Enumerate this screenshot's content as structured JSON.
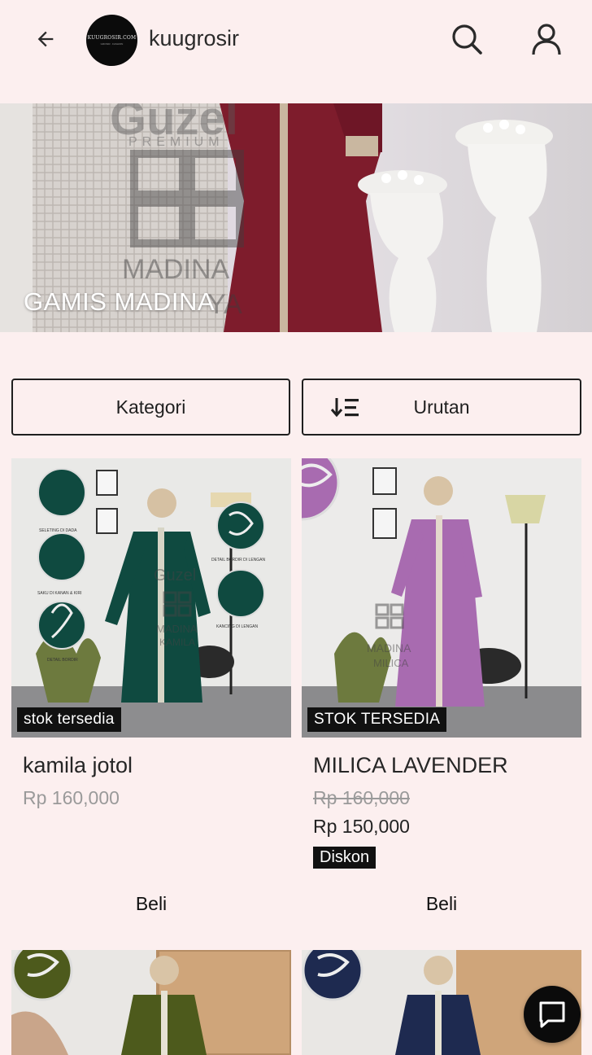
{
  "header": {
    "store_name": "kuugrosir",
    "logo_text": "KUUGROSIR.COM",
    "logo_subtext": "GROSIR · FASHION"
  },
  "banner": {
    "title": "GAMIS MADINA",
    "image_text": {
      "brand": "Guzel",
      "tier": "PREMIUM",
      "collection": "MADINA",
      "suffix": "YA"
    }
  },
  "filters": {
    "kategori_label": "Kategori",
    "urutan_label": "Urutan"
  },
  "products": [
    {
      "name": "kamila jotol",
      "stock": "stok tersedia",
      "price": "Rp 160,000",
      "buy_label": "Beli",
      "dress_color": "#0f4a40",
      "image_text": {
        "brand": "Guzel",
        "collection": "MADINA",
        "variant": "KAMILA",
        "callouts": [
          "SELETING DI DADA",
          "SAKU DI KANAN & KIRI",
          "DETAIL BORDIR",
          "DETAIL BORDIR DI LENGAN",
          "KANCING DI LENGAN"
        ]
      }
    },
    {
      "name": "MILICA LAVENDER",
      "stock": "STOK TERSEDIA",
      "price_old": "Rp 160,000",
      "price_new": "Rp 150,000",
      "discount_label": "Diskon",
      "buy_label": "Beli",
      "dress_color": "#a86bb0",
      "image_text": {
        "collection": "MADINA",
        "variant": "MILICA"
      }
    },
    {
      "dress_color": "#4d5a1c"
    },
    {
      "dress_color": "#1e2a50"
    }
  ],
  "colors": {
    "background": "#fcefef",
    "text": "#1f1f1f",
    "badge": "#111111"
  },
  "icons": {
    "back": "arrow-left",
    "search": "magnifier",
    "account": "person",
    "sort": "sort-descending",
    "chat": "chat-bubble"
  }
}
